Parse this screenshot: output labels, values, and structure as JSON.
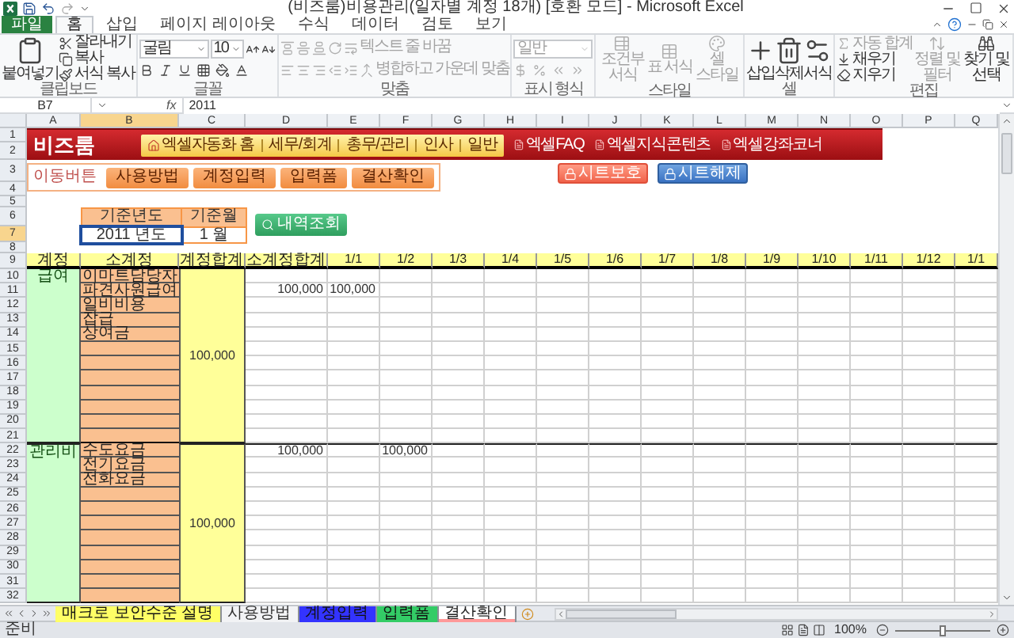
{
  "window": {
    "title": "(비즈룸)비용관리(일자별 계정 18개) [호환 모드] - Microsoft Excel"
  },
  "ribbon": {
    "tabs": [
      {
        "label": "파일",
        "kind": "file",
        "selected": false
      },
      {
        "label": "홈",
        "kind": "tab",
        "selected": true
      },
      {
        "label": "삽입",
        "kind": "tab",
        "selected": false
      },
      {
        "label": "페이지 레이아웃",
        "kind": "tab",
        "selected": false
      },
      {
        "label": "수식",
        "kind": "tab",
        "selected": false
      },
      {
        "label": "데이터",
        "kind": "tab",
        "selected": false
      },
      {
        "label": "검토",
        "kind": "tab",
        "selected": false
      },
      {
        "label": "보기",
        "kind": "tab",
        "selected": false
      }
    ],
    "groups": [
      {
        "kind": "clipboard",
        "label": "클립보드",
        "items": [
          {
            "label": "붙여넣기",
            "disabled": false
          },
          {
            "label": "잘라내기",
            "disabled": false
          },
          {
            "label": "복사",
            "disabled": false
          },
          {
            "label": "서식 복사",
            "disabled": false
          }
        ]
      },
      {
        "kind": "font",
        "label": "글꼴",
        "items": [
          {
            "label": "굴림",
            "disabled": false
          },
          {
            "label": "10",
            "disabled": false
          }
        ]
      },
      {
        "kind": "alignment",
        "label": "맞춤",
        "items": [
          {
            "label": "텍스트 줄 바꿈",
            "disabled": true
          },
          {
            "label": "병합하고 가운데 맞춤",
            "disabled": true
          }
        ]
      },
      {
        "kind": "number",
        "label": "표시 형식",
        "items": [
          {
            "label": "일반",
            "disabled": true
          }
        ]
      },
      {
        "kind": "styles",
        "label": "스타일",
        "items": [
          {
            "label": "조건부 서식",
            "disabled": true
          },
          {
            "label": "표 서식",
            "disabled": true
          },
          {
            "label": "셀 스타일",
            "disabled": true
          }
        ]
      },
      {
        "kind": "cells",
        "label": "셀",
        "items": [
          {
            "label": "삽입",
            "disabled": false
          },
          {
            "label": "삭제",
            "disabled": false
          },
          {
            "label": "서식",
            "disabled": false
          }
        ]
      },
      {
        "kind": "editing",
        "label": "편집",
        "items": [
          {
            "label": "자동 합계",
            "disabled": true
          },
          {
            "label": "채우기",
            "disabled": false
          },
          {
            "label": "지우기",
            "disabled": false
          },
          {
            "label": "정렬 및 필터",
            "disabled": true
          },
          {
            "label": "찾기 및 선택",
            "disabled": false
          }
        ]
      }
    ]
  },
  "formula_bar": {
    "name_box": "B7",
    "function_button": "fx",
    "value": "2011"
  },
  "columns": [
    {
      "letter": "A",
      "selected": false
    },
    {
      "letter": "B",
      "selected": true
    },
    {
      "letter": "C",
      "selected": false
    },
    {
      "letter": "D",
      "selected": false
    },
    {
      "letter": "E",
      "selected": false
    },
    {
      "letter": "F",
      "selected": false
    },
    {
      "letter": "G",
      "selected": false
    },
    {
      "letter": "H",
      "selected": false
    },
    {
      "letter": "I",
      "selected": false
    },
    {
      "letter": "J",
      "selected": false
    },
    {
      "letter": "K",
      "selected": false
    },
    {
      "letter": "L",
      "selected": false
    },
    {
      "letter": "M",
      "selected": false
    },
    {
      "letter": "N",
      "selected": false
    },
    {
      "letter": "O",
      "selected": false
    },
    {
      "letter": "P",
      "selected": false
    },
    {
      "letter": "Q",
      "selected": false
    }
  ],
  "top_rows": [
    {
      "number": "1",
      "selected": false
    },
    {
      "number": "2",
      "selected": false
    },
    {
      "number": "3",
      "selected": false
    },
    {
      "number": "4",
      "selected": false
    },
    {
      "number": "5",
      "selected": false
    },
    {
      "number": "6",
      "selected": false
    },
    {
      "number": "7",
      "selected": true
    },
    {
      "number": "8",
      "selected": false
    }
  ],
  "banner": {
    "logo": "비즈룸",
    "menu": [
      "엑셀자동화 홈",
      "세무/회계",
      "총무/관리",
      "인사",
      "일반"
    ],
    "links": [
      "엑셀FAQ",
      "엑셀지식콘텐츠",
      "엑셀강좌코너"
    ]
  },
  "navigation": {
    "label": "이동버튼",
    "buttons": [
      "사용방법",
      "계정입력",
      "입력폼",
      "결산확인"
    ]
  },
  "protection_buttons": [
    {
      "label": "시트보호",
      "kind": "protect"
    },
    {
      "label": "시트해제",
      "kind": "unprotect"
    }
  ],
  "period": {
    "headers": [
      "기준년도",
      "기준월"
    ],
    "values": [
      {
        "text": "2011 년도",
        "selected": true
      },
      {
        "text": "1 월",
        "selected": false
      }
    ],
    "button": "내역조회"
  },
  "table": {
    "header_row": {
      "number": "9",
      "selected": false
    },
    "columns": [
      "계정",
      "소계정",
      "계정합계",
      "소계정합계",
      "1/1",
      "1/2",
      "1/3",
      "1/4",
      "1/5",
      "1/6",
      "1/7",
      "1/8",
      "1/9",
      "1/10",
      "1/11",
      "1/12",
      "1/1"
    ],
    "groups": [
      {
        "account": "급여",
        "total": "100,000",
        "rows": [
          {
            "number": "10",
            "selected": false,
            "name": "이마트담당자"
          },
          {
            "number": "11",
            "selected": false,
            "name": "파견사원급여",
            "subtotal": "100,000",
            "days": [
              {
                "kind": "amount",
                "value": "100,000"
              }
            ]
          },
          {
            "number": "12",
            "selected": false,
            "name": "일비비용"
          },
          {
            "number": "13",
            "selected": false,
            "name": "잡급"
          },
          {
            "number": "14",
            "selected": false,
            "name": "상여금"
          },
          {
            "number": "15",
            "selected": false
          },
          {
            "number": "16",
            "selected": false
          },
          {
            "number": "17",
            "selected": false
          },
          {
            "number": "18",
            "selected": false
          },
          {
            "number": "19",
            "selected": false
          },
          {
            "number": "20",
            "selected": false
          },
          {
            "number": "21",
            "selected": false
          }
        ]
      },
      {
        "account": "관리비",
        "total": "100,000",
        "rows": [
          {
            "number": "22",
            "selected": false,
            "name": "수도요금",
            "subtotal": "100,000",
            "days": [
              {
                "kind": "blank"
              },
              {
                "kind": "amount",
                "value": "100,000"
              }
            ]
          },
          {
            "number": "23",
            "selected": false,
            "name": "전기요금"
          },
          {
            "number": "24",
            "selected": false,
            "name": "전화요금"
          },
          {
            "number": "25",
            "selected": false
          },
          {
            "number": "26",
            "selected": false
          },
          {
            "number": "27",
            "selected": false
          },
          {
            "number": "28",
            "selected": false
          },
          {
            "number": "29",
            "selected": false
          },
          {
            "number": "30",
            "selected": false
          },
          {
            "number": "31",
            "selected": false
          },
          {
            "number": "32",
            "selected": false
          }
        ]
      }
    ]
  },
  "sheet_tabs": [
    {
      "label": "매크로 보안수준 설명",
      "color": "#ffff66",
      "selected": false
    },
    {
      "label": "사용방법",
      "selected": false
    },
    {
      "label": "계정입력",
      "color": "#3333ff",
      "selected": false
    },
    {
      "label": "입력폼",
      "color": "#33cc66",
      "selected": false
    },
    {
      "label": "결산확인",
      "color": "#ff9999",
      "selected": true
    }
  ],
  "status_bar": {
    "status": "준비",
    "zoom": {
      "label": "100%",
      "level": 0.5
    }
  }
}
